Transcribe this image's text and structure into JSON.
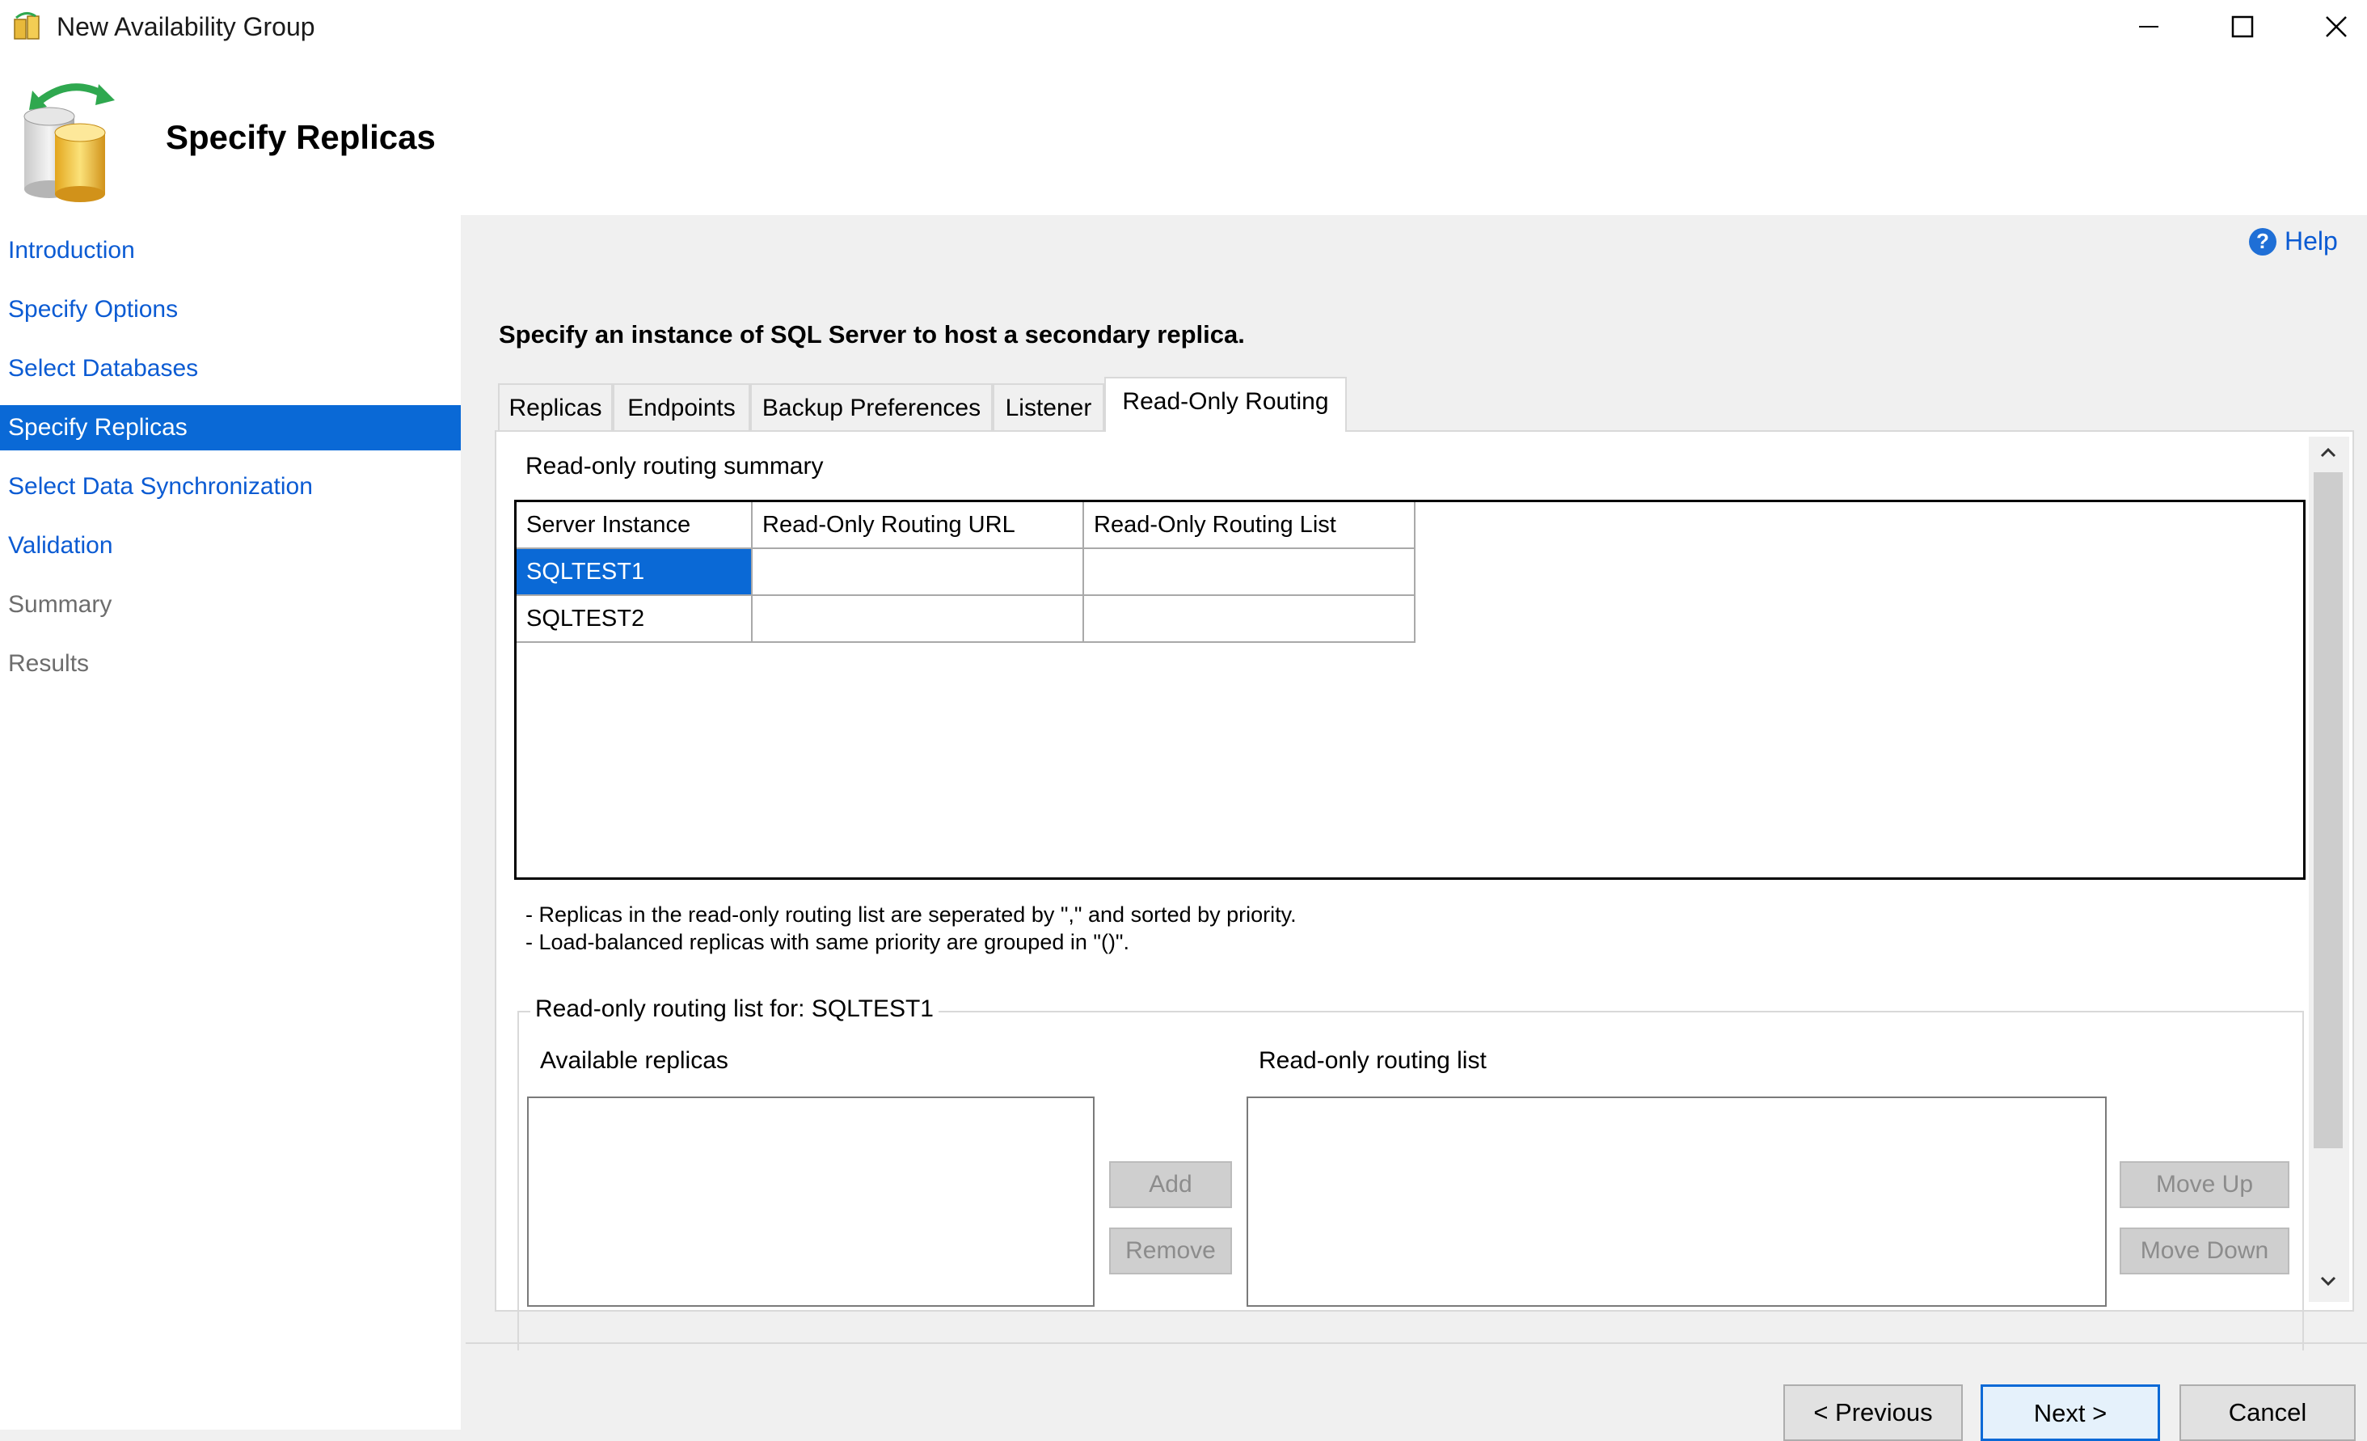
{
  "window": {
    "title": "New Availability Group",
    "controls": {
      "minimize": "minimize",
      "maximize": "maximize",
      "close": "close"
    }
  },
  "header": {
    "title": "Specify Replicas"
  },
  "sidebar": {
    "items": [
      {
        "label": "Introduction",
        "state": "link"
      },
      {
        "label": "Specify Options",
        "state": "link"
      },
      {
        "label": "Select Databases",
        "state": "link"
      },
      {
        "label": "Specify Replicas",
        "state": "active"
      },
      {
        "label": "Select Data Synchronization",
        "state": "link"
      },
      {
        "label": "Validation",
        "state": "link"
      },
      {
        "label": "Summary",
        "state": "disabled"
      },
      {
        "label": "Results",
        "state": "disabled"
      }
    ]
  },
  "help": {
    "label": "Help"
  },
  "main": {
    "instruction": "Specify an instance of SQL Server to host a secondary replica.",
    "tabs": [
      {
        "label": "Replicas"
      },
      {
        "label": "Endpoints"
      },
      {
        "label": "Backup Preferences"
      },
      {
        "label": "Listener"
      },
      {
        "label": "Read-Only Routing",
        "active": true
      }
    ],
    "summary_label": "Read-only routing summary",
    "grid": {
      "columns": [
        "Server Instance",
        "Read-Only Routing URL",
        "Read-Only Routing List"
      ],
      "rows": [
        {
          "server": "SQLTEST1",
          "url": "",
          "list": "",
          "selected": true
        },
        {
          "server": "SQLTEST2",
          "url": "",
          "list": "",
          "selected": false
        }
      ]
    },
    "notes": [
      "- Replicas in the read-only routing list are seperated by \",\" and sorted by priority.",
      "- Load-balanced replicas with same priority are grouped in \"()\"."
    ],
    "routing_group": {
      "title": "Read-only routing list for: SQLTEST1",
      "available_label": "Available replicas",
      "routing_label": "Read-only routing list",
      "add_label": "Add",
      "remove_label": "Remove",
      "move_up_label": "Move Up",
      "move_down_label": "Move Down"
    }
  },
  "footer": {
    "previous_label": "< Previous",
    "next_label": "Next >",
    "cancel_label": "Cancel"
  },
  "colors": {
    "accent": "#0a69d6",
    "link": "#0b5bd3",
    "window_bg": "#f0f0f0"
  }
}
